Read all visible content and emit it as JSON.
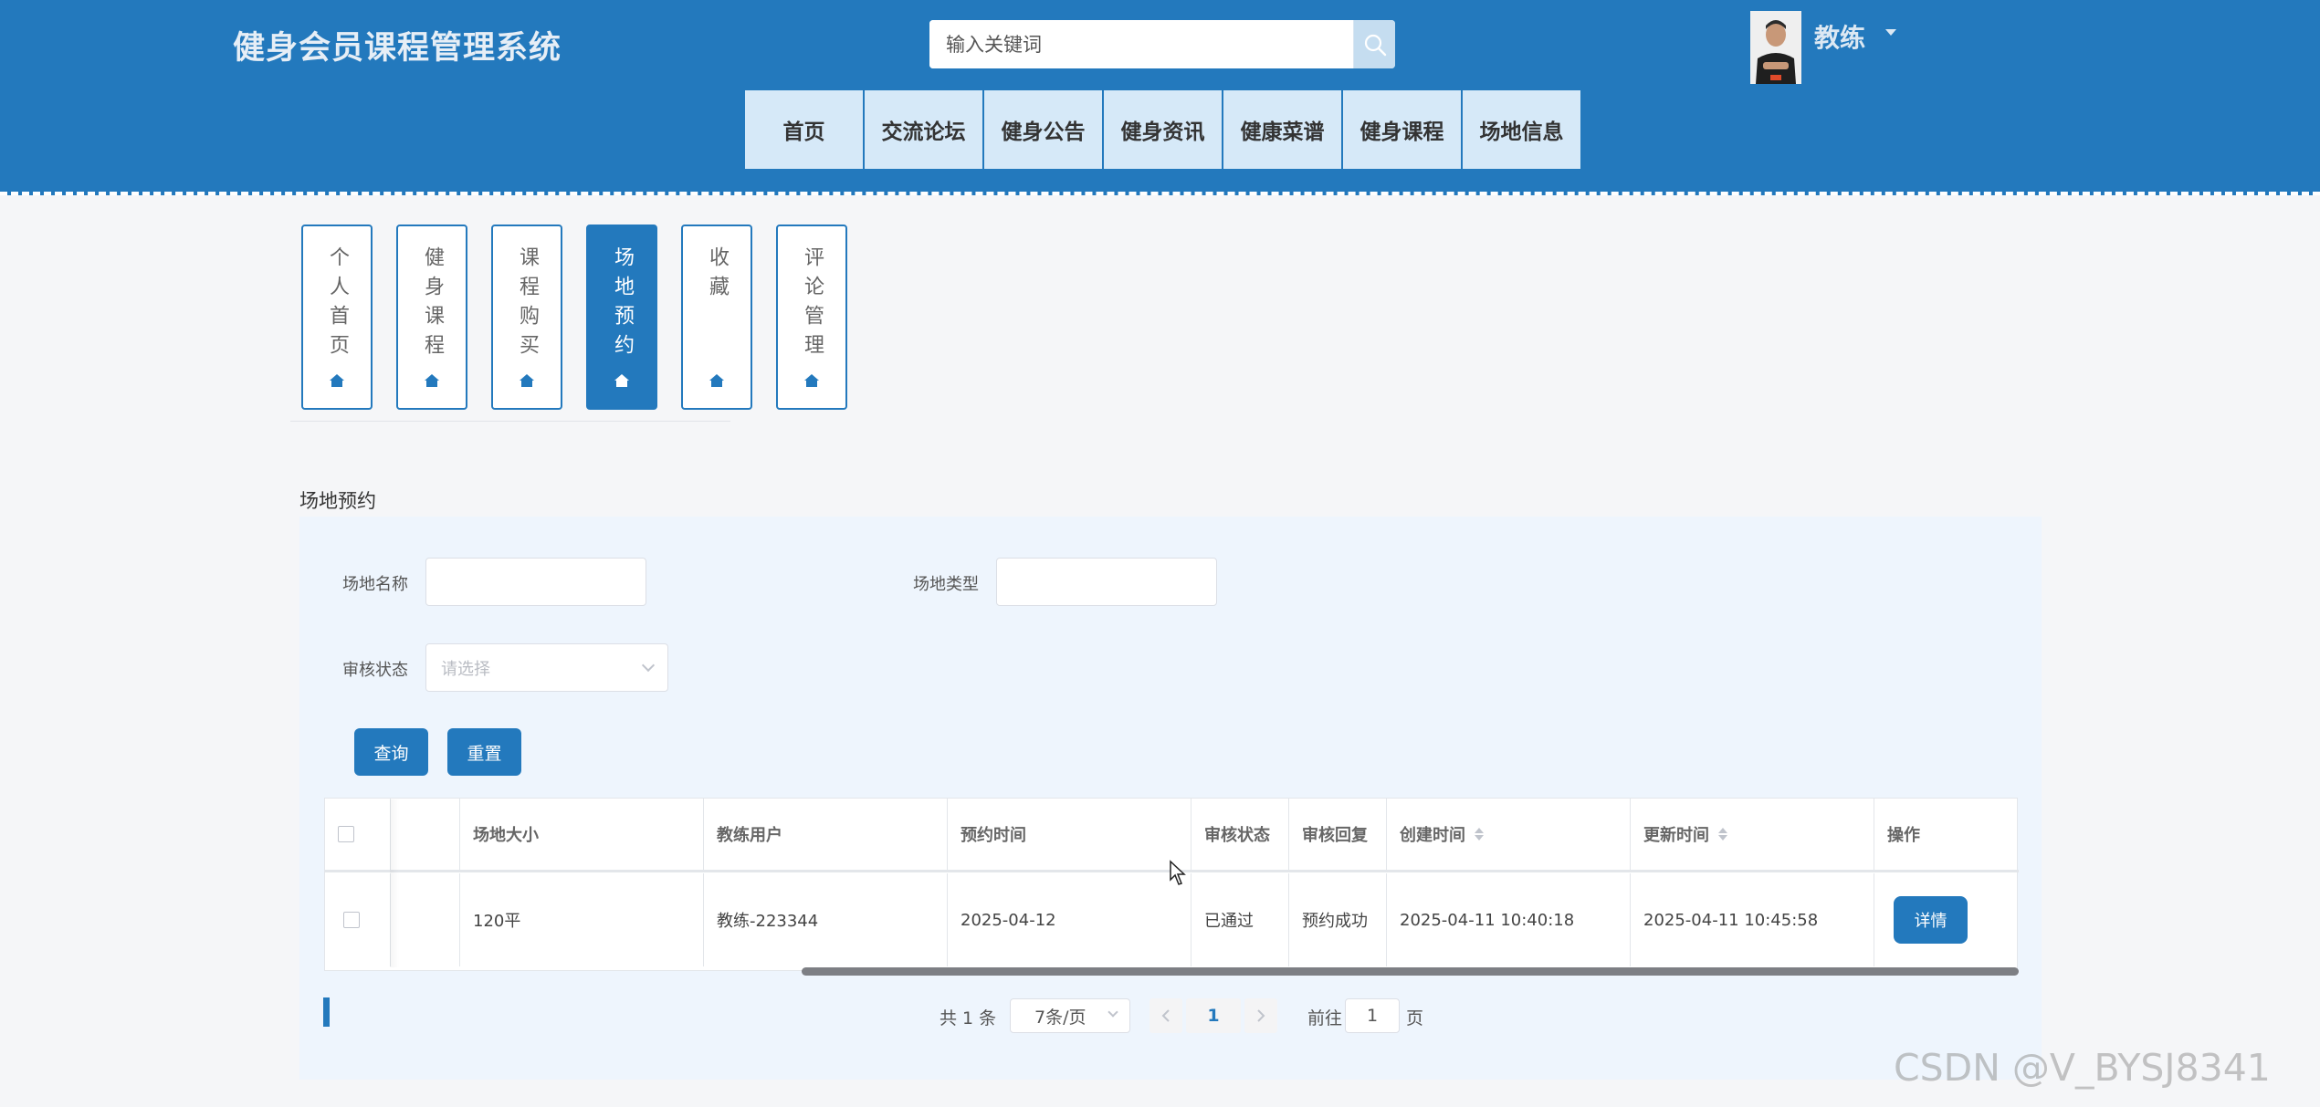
{
  "header": {
    "site_title": "健身会员课程管理系统",
    "search_placeholder": "输入关键词",
    "user_name": "教练"
  },
  "nav": {
    "items": [
      "首页",
      "交流论坛",
      "健身公告",
      "健身资讯",
      "健康菜谱",
      "健身课程",
      "场地信息"
    ]
  },
  "side_tabs": {
    "items": [
      {
        "label": "个人首页",
        "active": false
      },
      {
        "label": "健身课程",
        "active": false
      },
      {
        "label": "课程购买",
        "active": false
      },
      {
        "label": "场地预约",
        "active": true
      },
      {
        "label": "收藏",
        "active": false
      },
      {
        "label": "评论管理",
        "active": false
      }
    ]
  },
  "section": {
    "title": "场地预约"
  },
  "filters": {
    "venue_name_label": "场地名称",
    "venue_type_label": "场地类型",
    "review_status_label": "审核状态",
    "review_status_placeholder": "请选择",
    "query_button": "查询",
    "reset_button": "重置"
  },
  "table": {
    "headers": {
      "size": "场地大小",
      "coach_user": "教练用户",
      "booking_time": "预约时间",
      "review_status": "审核状态",
      "review_reply": "审核回复",
      "created_time": "创建时间",
      "updated_time": "更新时间",
      "actions": "操作"
    },
    "rows": [
      {
        "size": "120平",
        "coach_user": "教练-223344",
        "booking_time": "2025-04-12",
        "review_status": "已通过",
        "review_reply": "预约成功",
        "created_time": "2025-04-11 10:40:18",
        "updated_time": "2025-04-11 10:45:58",
        "action_label": "详情"
      }
    ]
  },
  "pagination": {
    "total_text": "共 1 条",
    "page_size": "7条/页",
    "current_page": "1",
    "goto_prefix": "前往",
    "goto_value": "1",
    "goto_suffix": "页"
  },
  "watermark": "CSDN @V_BYSJ8341",
  "colors": {
    "primary": "#2379bd",
    "nav_item_bg": "#d6e9f8",
    "panel_bg": "#eef5fd"
  }
}
